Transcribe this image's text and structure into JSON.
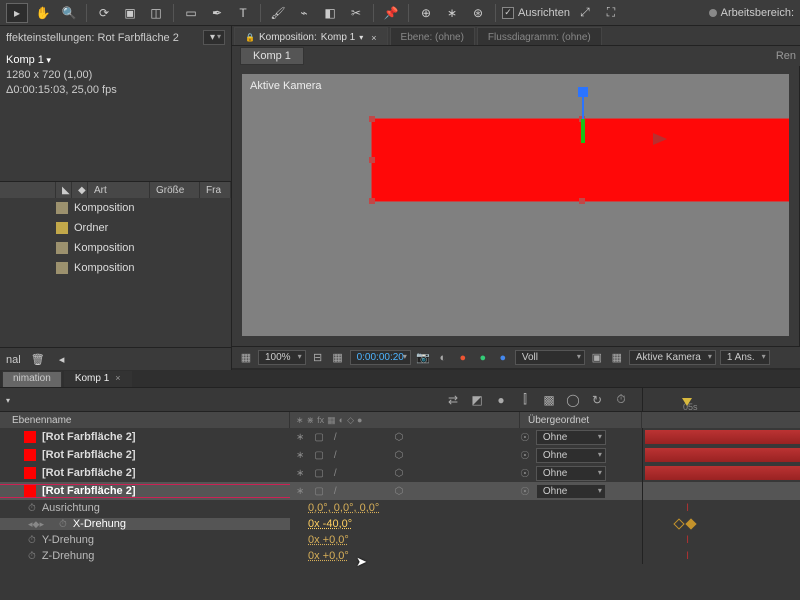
{
  "topbar": {
    "align_label": "Ausrichten",
    "workspace_label": "Arbeitsbereich:"
  },
  "fx": {
    "title": "ffekteinstellungen: Rot Farbfläche 2",
    "comp_name": "Komp 1",
    "dims": "1280 x 720 (1,00)",
    "duration": "Δ0:00:15:03, 25,00 fps"
  },
  "project": {
    "cols": {
      "type": "Art",
      "size": "Größe",
      "fr": "Fra"
    },
    "items": [
      {
        "label": "Komposition",
        "kind": "comp"
      },
      {
        "label": "Ordner",
        "kind": "folder"
      },
      {
        "label": "Komposition",
        "kind": "comp"
      },
      {
        "label": "Komposition",
        "kind": "comp"
      }
    ],
    "bottom_tab": "nal"
  },
  "viewtabs": {
    "comp_prefix": "Komposition:",
    "comp_name": "Komp 1",
    "ebene": "Ebene: (ohne)",
    "fluss": "Flussdiagramm: (ohne)"
  },
  "subtab": "Komp 1",
  "renq": "Ren",
  "camera_label": "Aktive Kamera",
  "viewerbar": {
    "zoom": "100%",
    "time": "0:00:00:20",
    "res": "Voll",
    "view": "Aktive Kamera",
    "ans": "1 Ans."
  },
  "tltabs": {
    "anim": "nimation",
    "comp": "Komp 1"
  },
  "layerhead": {
    "name": "Ebenenname",
    "parent": "Übergeordnet"
  },
  "layers": [
    {
      "name": "[Rot Farbfläche 2]"
    },
    {
      "name": "[Rot Farbfläche 2]"
    },
    {
      "name": "[Rot Farbfläche 2]"
    },
    {
      "name": "[Rot Farbfläche 2]"
    }
  ],
  "parent_none": "Ohne",
  "props": {
    "orient": {
      "label": "Ausrichtung",
      "value": "0,0°, 0,0°, 0,0°"
    },
    "xrot": {
      "label": "X-Drehung",
      "value": "0x -40,0°"
    },
    "yrot": {
      "label": "Y-Drehung",
      "value": "0x +0,0°"
    },
    "zrot": {
      "label": "Z-Drehung",
      "value": "0x +0,0°"
    }
  },
  "ruler": {
    "t1": "05s"
  }
}
